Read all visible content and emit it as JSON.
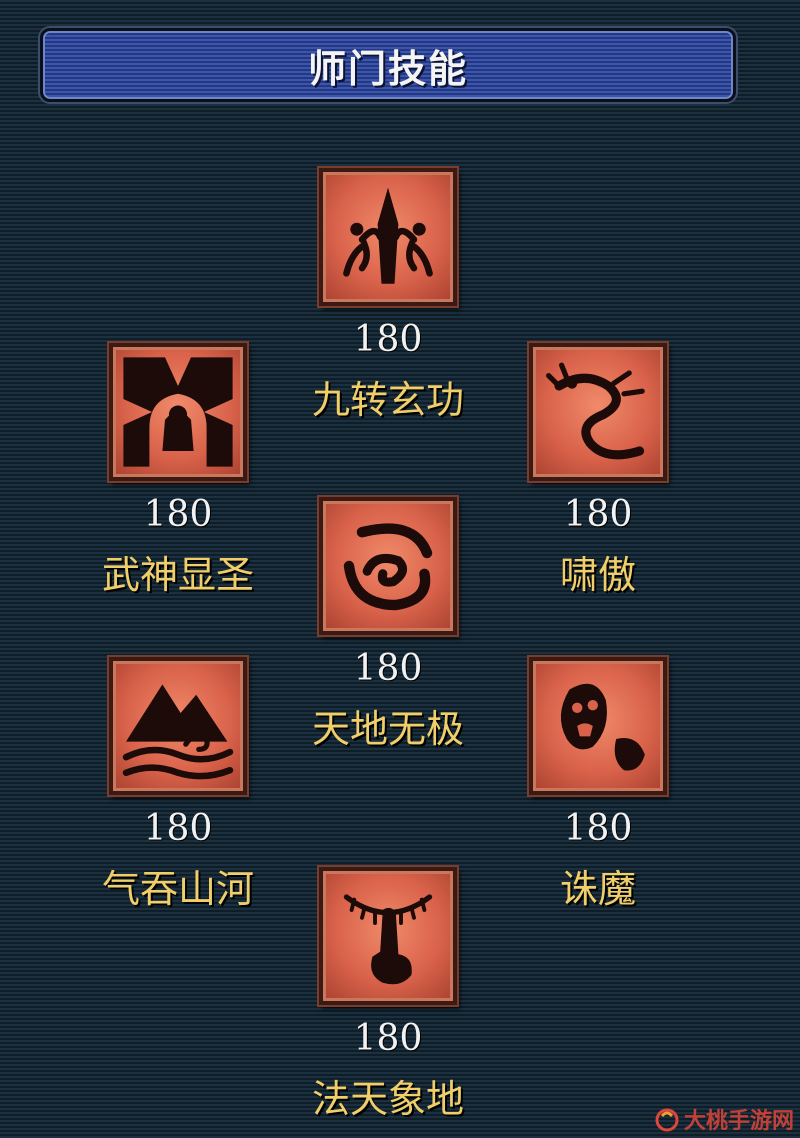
{
  "panel": {
    "title": "师门技能"
  },
  "skills": [
    {
      "level": "180",
      "name": "九转玄功",
      "icon": "warrior-sword-icon"
    },
    {
      "level": "180",
      "name": "武神显圣",
      "icon": "radiant-god-icon"
    },
    {
      "level": "180",
      "name": "啸傲",
      "icon": "dragon-icon"
    },
    {
      "level": "180",
      "name": "天地无极",
      "icon": "vortex-icon"
    },
    {
      "level": "180",
      "name": "气吞山河",
      "icon": "mountain-wave-icon"
    },
    {
      "level": "180",
      "name": "诛魔",
      "icon": "ghost-icon"
    },
    {
      "level": "180",
      "name": "法天象地",
      "icon": "praying-hand-icon"
    }
  ],
  "watermark": {
    "text": "大桃手游网"
  },
  "colors": {
    "skill_name": "#f0cf6a",
    "level": "#f2f2f2",
    "title_bar": "#2a3f8f",
    "icon_bg": "#d9624a"
  }
}
